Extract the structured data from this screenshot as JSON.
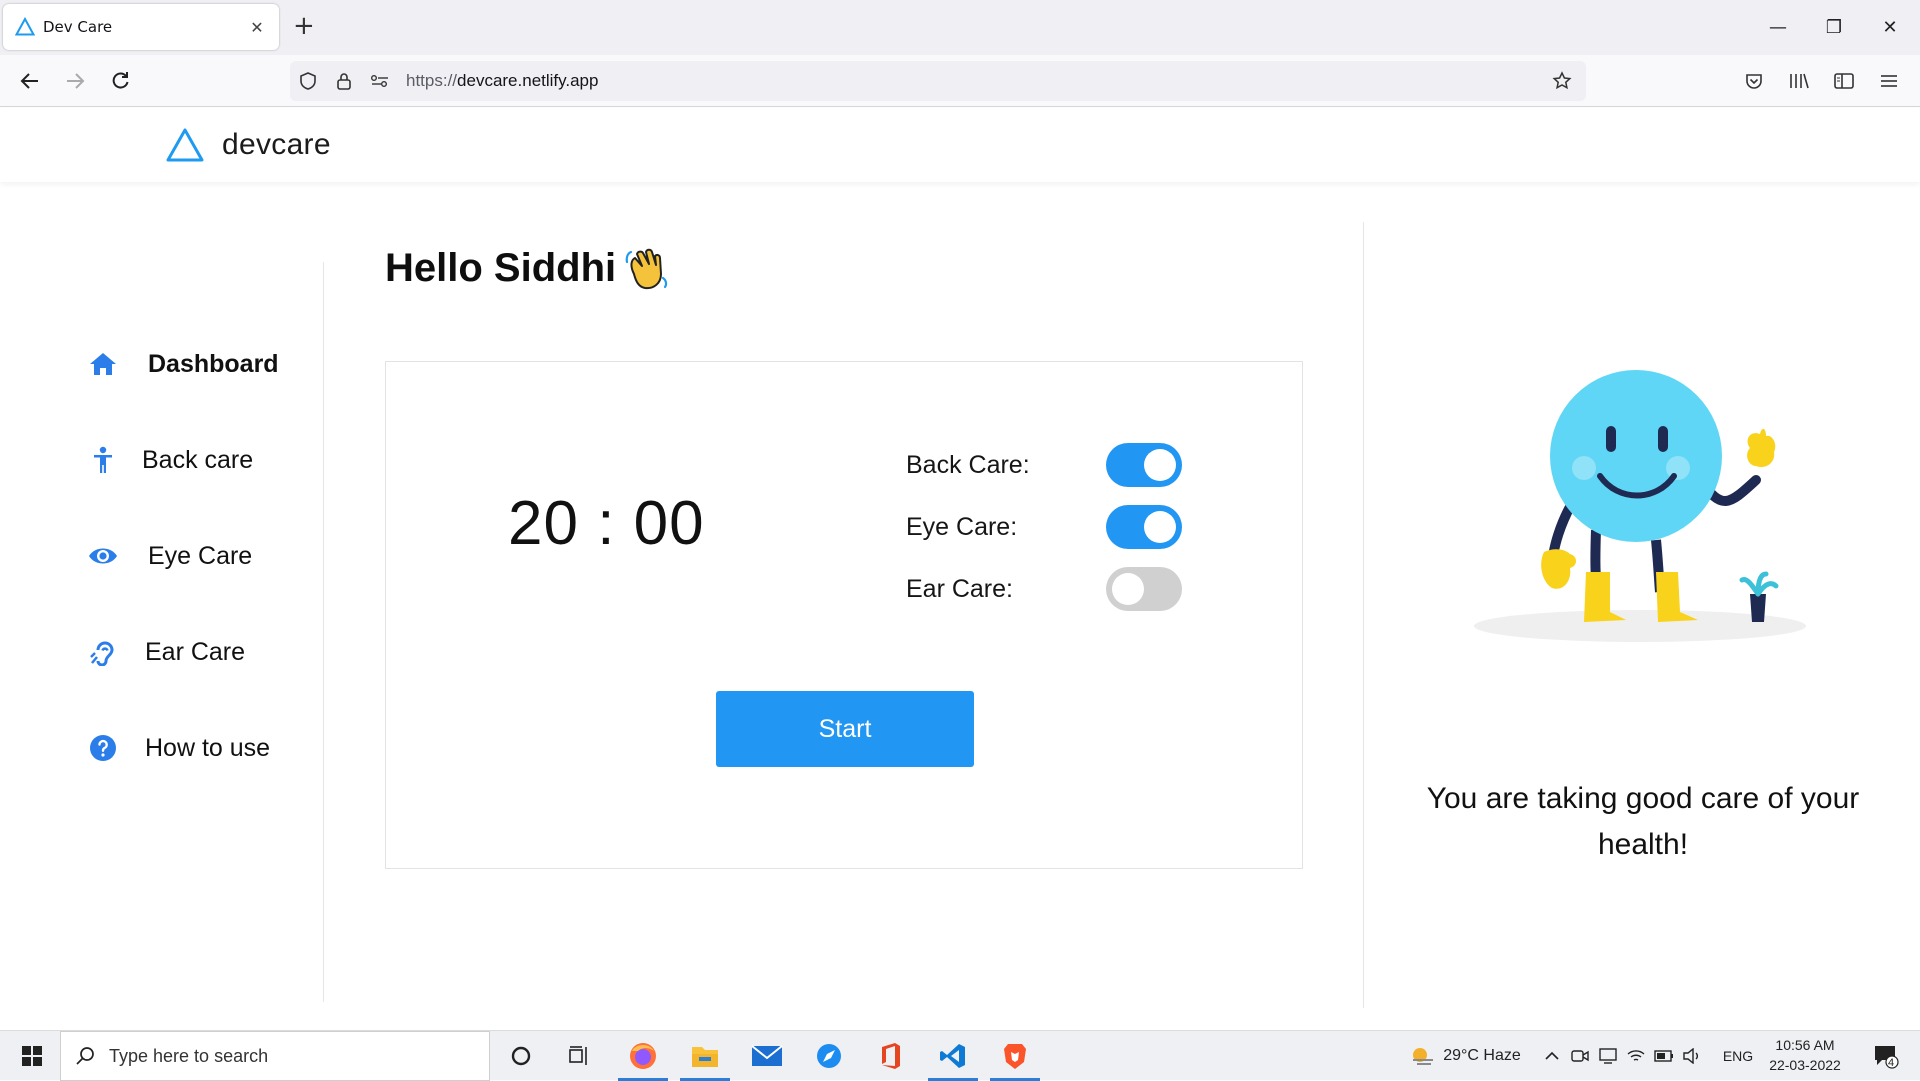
{
  "browser": {
    "tab_title": "Dev Care",
    "tab_close": "✕",
    "new_tab": "+",
    "url_protocol": "https://",
    "url_host": "devcare.netlify.app",
    "window_controls": {
      "minimize": "—",
      "restore": "❐",
      "close": "✕"
    }
  },
  "header": {
    "brand": "devcare",
    "accent_color": "#1e9bf0"
  },
  "sidebar": {
    "items": [
      {
        "label": "Dashboard",
        "icon": "home-icon",
        "active": true
      },
      {
        "label": "Back care",
        "icon": "person-icon",
        "active": false
      },
      {
        "label": "Eye Care",
        "icon": "eye-icon",
        "active": false
      },
      {
        "label": "Ear Care",
        "icon": "ear-icon",
        "active": false
      },
      {
        "label": "How to use",
        "icon": "help-icon",
        "active": false
      }
    ]
  },
  "main": {
    "greeting": "Hello Siddhi",
    "greeting_emoji": "waving-hand-icon",
    "timer": "20 : 00",
    "options": [
      {
        "label": "Back Care:",
        "enabled": true
      },
      {
        "label": "Eye Care:",
        "enabled": true
      },
      {
        "label": "Ear Care:",
        "enabled": false
      }
    ],
    "start_label": "Start",
    "primary_color": "#2196f3"
  },
  "aside": {
    "message": "You are taking good care of your health!"
  },
  "taskbar": {
    "search_placeholder": "Type here to search",
    "weather": "29°C  Haze",
    "lang": "ENG",
    "time": "10:56 AM",
    "date": "22-03-2022",
    "notifications": "4"
  }
}
